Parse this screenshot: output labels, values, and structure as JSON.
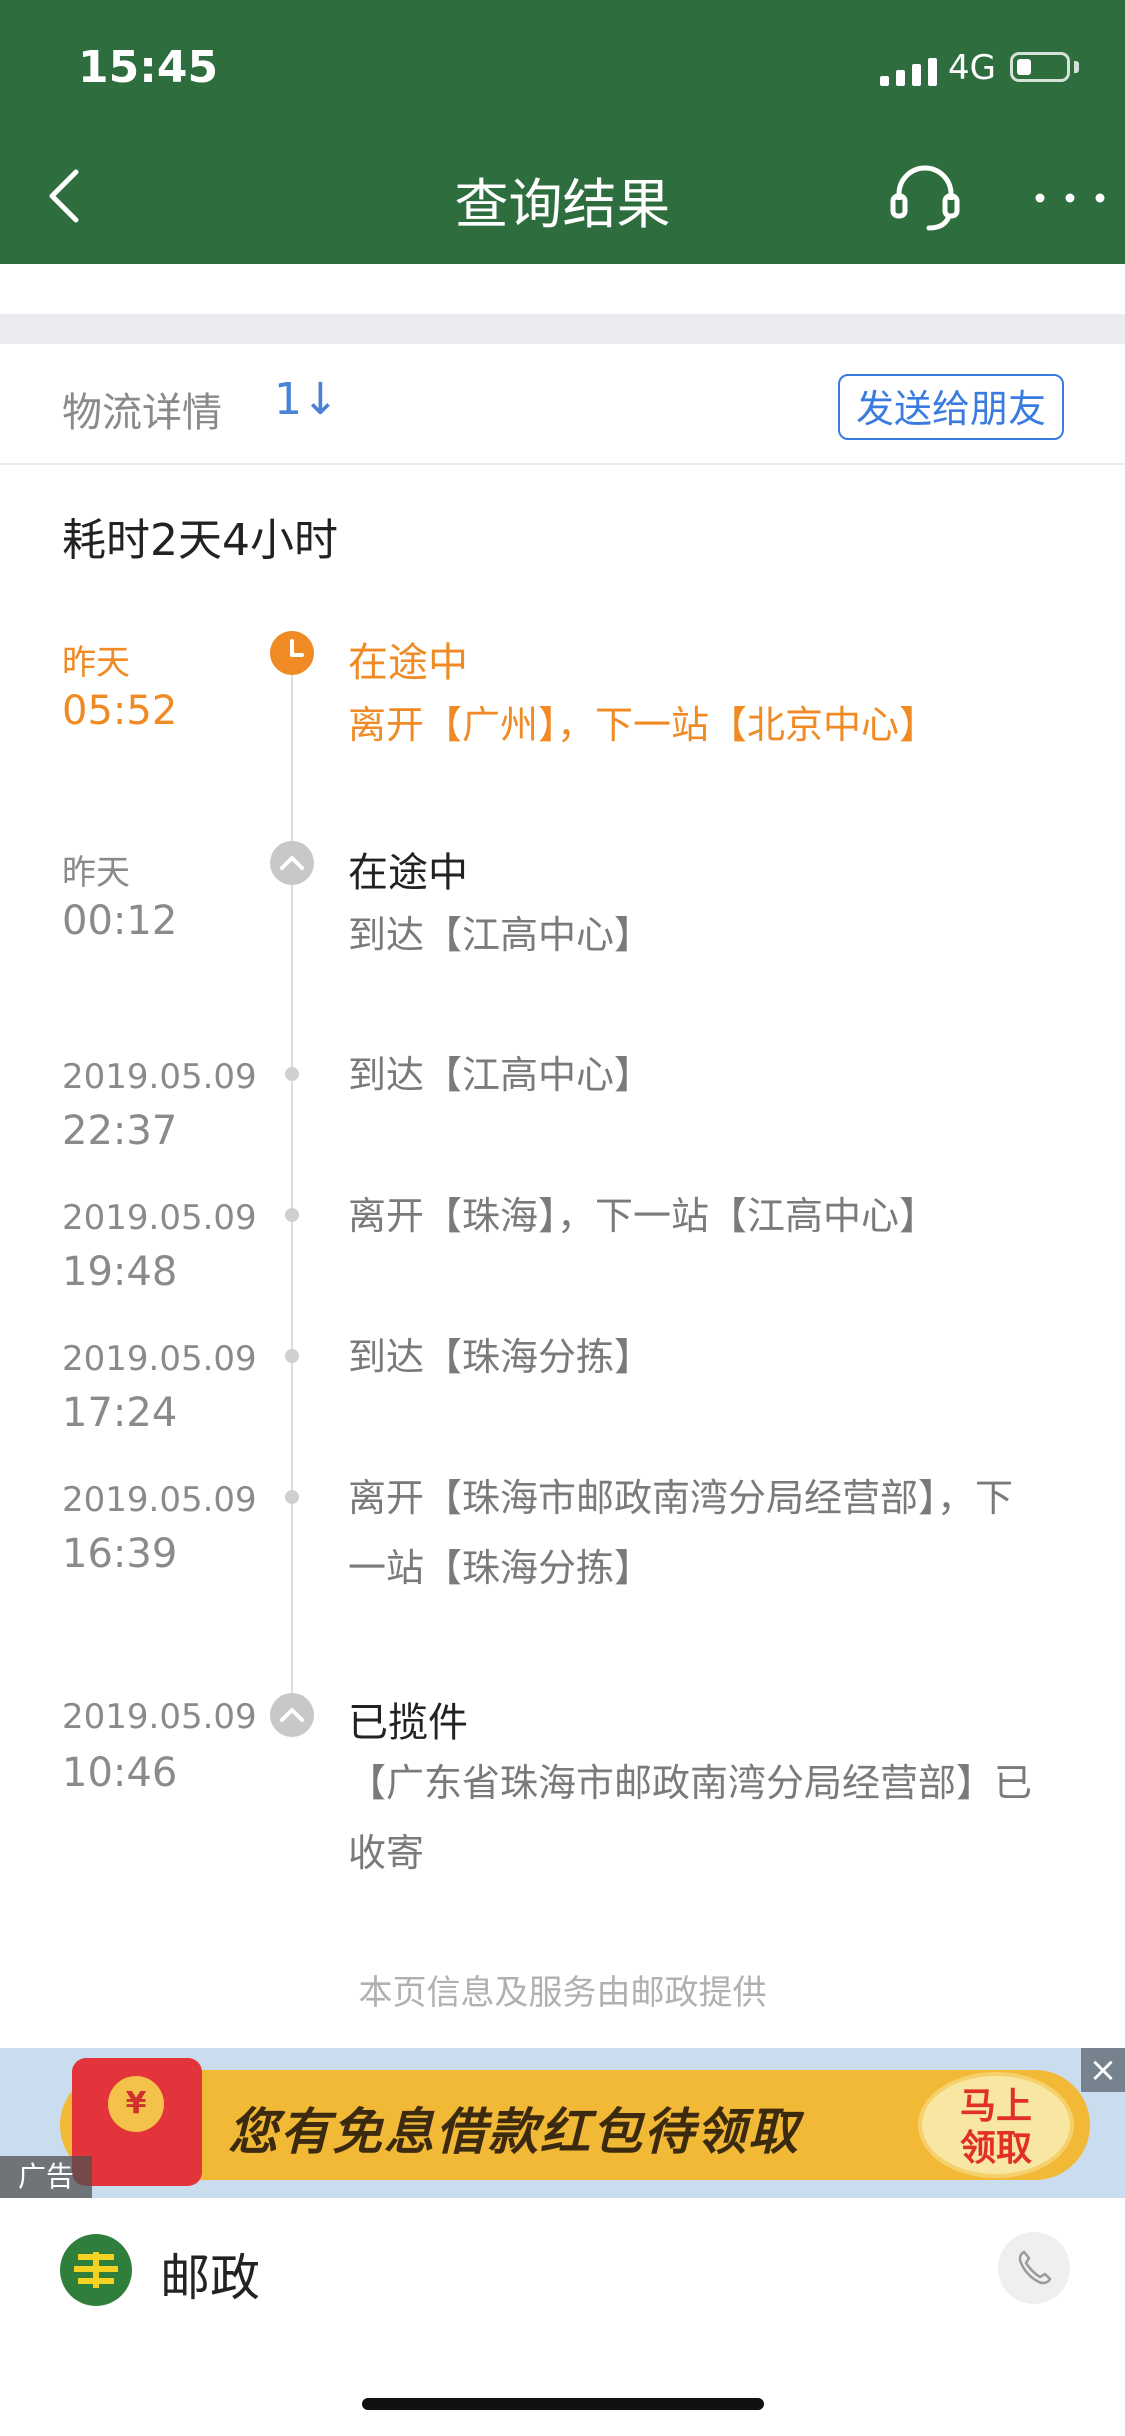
{
  "status_bar": {
    "time": "15:45",
    "network": "4G"
  },
  "header": {
    "title": "查询结果"
  },
  "section": {
    "title": "物流详情",
    "sort_label": "1↓",
    "send_button": "发送给朋友"
  },
  "summary": {
    "duration": "耗时2天4小时"
  },
  "timeline": [
    {
      "date": "昨天",
      "time": "05:52",
      "status": "在途中",
      "desc": "离开【广州】，下一站【北京中心】",
      "marker": "clock",
      "highlight": true
    },
    {
      "date": "昨天",
      "time": "00:12",
      "status": "在途中",
      "desc": "到达【江高中心】",
      "marker": "chevron",
      "highlight": false
    },
    {
      "date": "2019.05.09",
      "time": "22:37",
      "desc": "到达【江高中心】",
      "marker": "dot"
    },
    {
      "date": "2019.05.09",
      "time": "19:48",
      "desc": "离开【珠海】，下一站【江高中心】",
      "marker": "dot"
    },
    {
      "date": "2019.05.09",
      "time": "17:24",
      "desc": "到达【珠海分拣】",
      "marker": "dot"
    },
    {
      "date": "2019.05.09",
      "time": "16:39",
      "desc": "离开【珠海市邮政南湾分局经营部】，下一站【珠海分拣】",
      "marker": "dot"
    },
    {
      "date": "2019.05.09",
      "time": "10:46",
      "status": "已揽件",
      "desc": "【广东省珠海市邮政南湾分局经营部】已收寄",
      "marker": "chevron"
    }
  ],
  "footer_note": "本页信息及服务由邮政提供",
  "ad": {
    "text": "您有免息借款红包待领取",
    "cta_line1": "马上",
    "cta_line2": "领取",
    "label": "广告",
    "coin": "¥",
    "close": "×"
  },
  "bottom_bar": {
    "company": "邮政"
  },
  "colors": {
    "header_bg": "#2e6e3e",
    "accent_orange": "#f08a24",
    "link_blue": "#3a7be0"
  }
}
